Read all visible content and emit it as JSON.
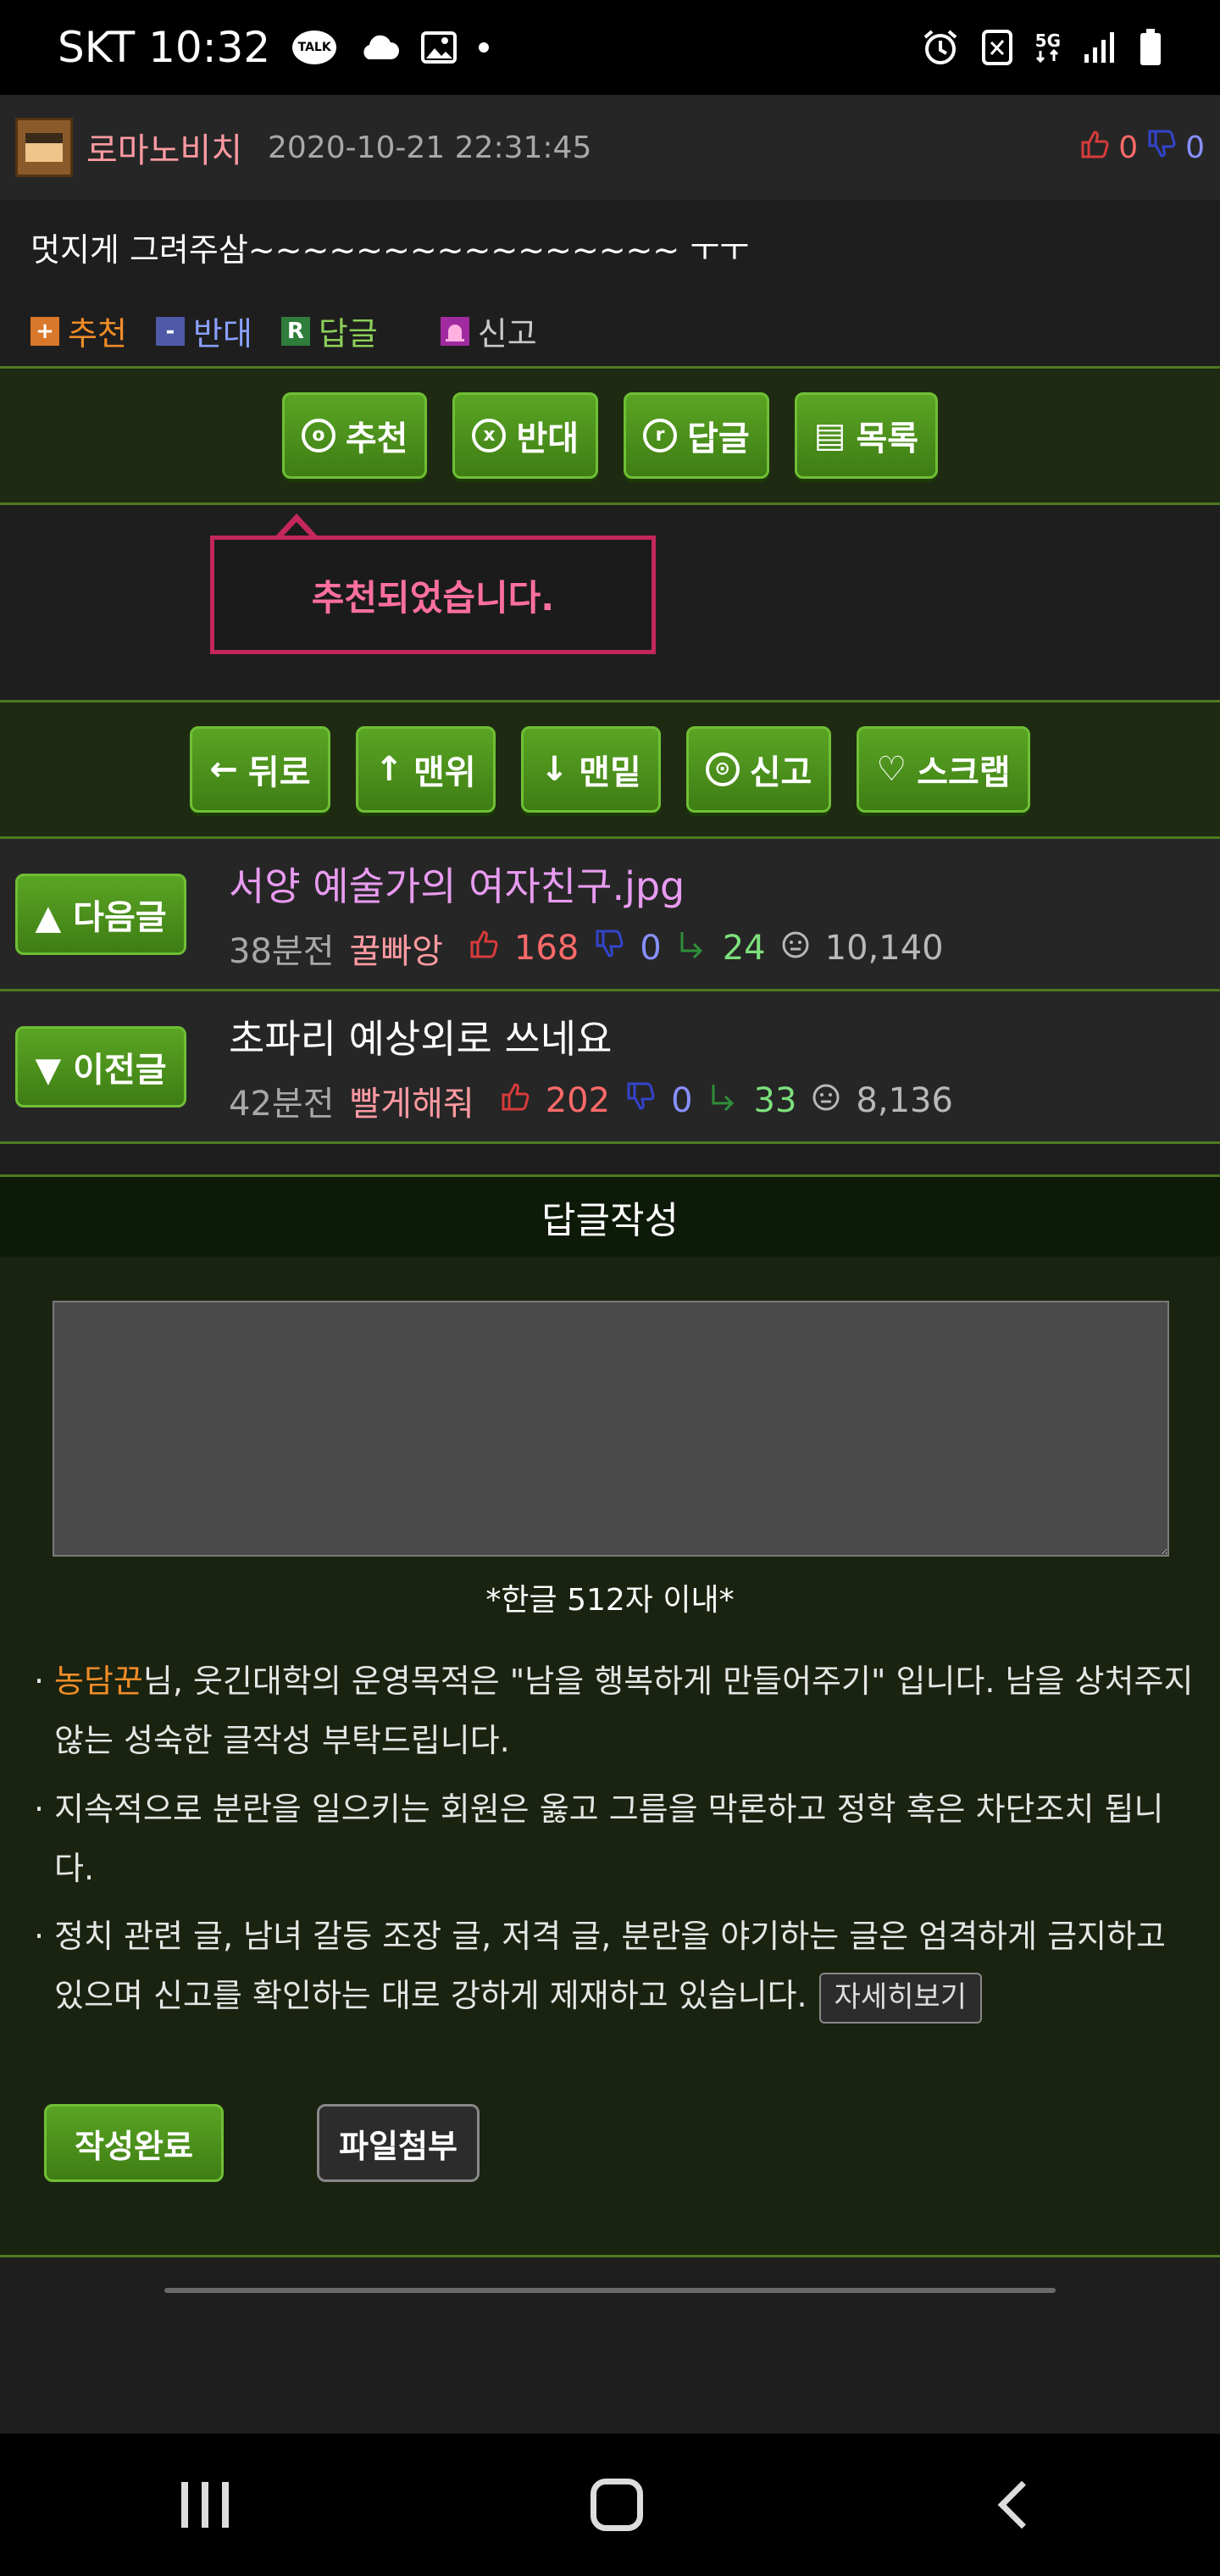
{
  "status_bar": {
    "carrier_time": "SKT 10:32",
    "left_icons": [
      "talk-icon",
      "cloud-icon",
      "image-icon",
      "dot-icon"
    ],
    "right_icons": [
      "alarm-icon",
      "nfc-icon",
      "5g-icon",
      "signal-icon",
      "battery-icon"
    ],
    "talk_label": "TALK",
    "network_label": "5G"
  },
  "comment": {
    "author": "로마노비치",
    "date": "2020-10-21 22:31:45",
    "up_count": "0",
    "down_count": "0",
    "text": "멋지게 그려주삼~~~~~~~~~~~~~~~~ ㅜㅜ",
    "actions": [
      {
        "icon": "+",
        "label": "추천"
      },
      {
        "icon": "-",
        "label": "반대"
      },
      {
        "icon": "R",
        "label": "답글"
      },
      {
        "icon": "",
        "label": "신고"
      }
    ]
  },
  "action_bar": {
    "buttons": [
      {
        "icon": "o",
        "label": "추천"
      },
      {
        "icon": "x",
        "label": "반대"
      },
      {
        "icon": "r",
        "label": "답글"
      },
      {
        "icon": "▤",
        "label": "목록"
      }
    ]
  },
  "toast": {
    "message": "추천되었습니다."
  },
  "nav_bar": {
    "buttons": [
      {
        "icon": "←",
        "label": "뒤로"
      },
      {
        "icon": "↑",
        "label": "맨위"
      },
      {
        "icon": "↓",
        "label": "맨밑"
      },
      {
        "icon": "⊙",
        "label": "신고"
      },
      {
        "icon": "♡",
        "label": "스크랩"
      }
    ]
  },
  "next_post": {
    "button_label": "▲ 다음글",
    "title": "서양 예술가의 여자친구.jpg",
    "time": "38분전",
    "author": "꿀빠앙",
    "up": "168",
    "down": "0",
    "replies": "24",
    "views": "10,140",
    "title_color": "#e89bf0"
  },
  "prev_post": {
    "button_label": "▼ 이전글",
    "title": "초파리 예상외로 쓰네요",
    "time": "42분전",
    "author": "빨게해줘",
    "up": "202",
    "down": "0",
    "replies": "33",
    "views": "8,136",
    "title_color": "#ffffff"
  },
  "reply": {
    "title": "답글작성",
    "limit": "*한글 512자 이내*",
    "rules": [
      {
        "user": "농담꾼",
        "text": "님, 웃긴대학의 운영목적은 \"남을 행복하게 만들어주기\" 입니다. 남을 상처주지 않는 성숙한 글작성 부탁드립니다."
      },
      {
        "user": "",
        "text": "지속적으로 분란을 일으키는 회원은 옳고 그름을 막론하고 정학 혹은 차단조치 됩니다."
      },
      {
        "user": "",
        "text": "정치 관련 글, 남녀 갈등 조장 글, 저격 글, 분란을 야기하는 글은 엄격하게 금지하고 있으며 신고를 확인하는 대로 강하게 제재하고 있습니다."
      }
    ],
    "more_label": "자세히보기",
    "submit_label": "작성완료",
    "file_label": "파일첨부"
  },
  "colors": {
    "accent_green": "#4e7a1f",
    "toast_border": "#c4285a",
    "author_pink": "#ff9aa2"
  }
}
